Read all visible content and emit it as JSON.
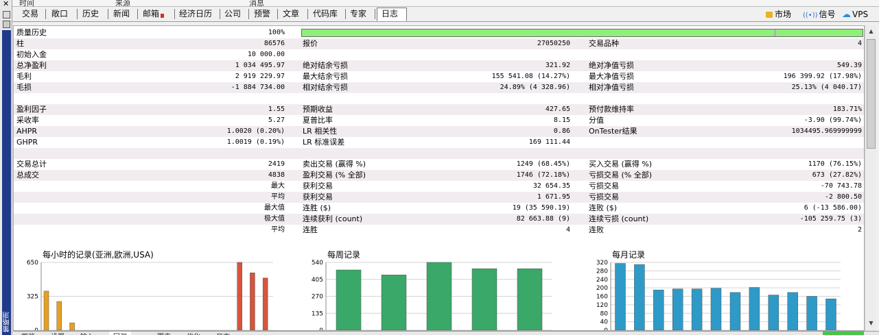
{
  "top_remnant": [
    "时间",
    "来源",
    "消息"
  ],
  "tabs": [
    "交易",
    "敞口",
    "历史",
    "新闻",
    "邮箱",
    "经济日历",
    "公司",
    "预警",
    "文章",
    "代码库",
    "专家",
    "日志"
  ],
  "active_tab": "日志",
  "top_right": {
    "market": "市场",
    "signals": "信号",
    "vps": "VPS"
  },
  "side_label": "策略测试",
  "quality": {
    "label": "质量历史",
    "value": "100%",
    "fill_fraction": 1.0
  },
  "rows": [
    {
      "c1l": "柱",
      "c1v": "86576",
      "c2l": "报价",
      "c2v": "27050250",
      "c3l": "交易品种",
      "c3v": "4"
    },
    {
      "c1l": "初始入金",
      "c1v": "10 000.00",
      "c2l": "",
      "c2v": "",
      "c3l": "",
      "c3v": ""
    },
    {
      "c1l": "总净盈利",
      "c1v": "1 034 495.97",
      "c2l": "绝对结余亏损",
      "c2v": "321.92",
      "c3l": "绝对净值亏损",
      "c3v": "549.39"
    },
    {
      "c1l": "毛利",
      "c1v": "2 919 229.97",
      "c2l": "最大结余亏损",
      "c2v": "155 541.08 (14.27%)",
      "c3l": "最大净值亏损",
      "c3v": "196 399.92 (17.98%)"
    },
    {
      "c1l": "毛损",
      "c1v": "-1 884 734.00",
      "c2l": "相对结余亏损",
      "c2v": "24.89% (4 328.96)",
      "c3l": "相对净值亏损",
      "c3v": "25.13% (4 040.17)"
    },
    {
      "c1l": "",
      "c1v": "",
      "c2l": "",
      "c2v": "",
      "c3l": "",
      "c3v": ""
    },
    {
      "c1l": "盈利因子",
      "c1v": "1.55",
      "c2l": "预期收益",
      "c2v": "427.65",
      "c3l": "预付款维持率",
      "c3v": "183.71%"
    },
    {
      "c1l": "采收率",
      "c1v": "5.27",
      "c2l": "夏普比率",
      "c2v": "8.15",
      "c3l": "分值",
      "c3v": "-3.90 (99.74%)"
    },
    {
      "c1l": "AHPR",
      "c1v": "1.0020 (0.20%)",
      "c2l": "LR 相关性",
      "c2v": "0.86",
      "c3l": "OnTester结果",
      "c3v": "1034495.969999999"
    },
    {
      "c1l": "GHPR",
      "c1v": "1.0019 (0.19%)",
      "c2l": "LR 标准误差",
      "c2v": "169 111.44",
      "c3l": "",
      "c3v": ""
    },
    {
      "c1l": "",
      "c1v": "",
      "c2l": "",
      "c2v": "",
      "c3l": "",
      "c3v": ""
    },
    {
      "c1l": "交易总计",
      "c1v": "2419",
      "c2l": "卖出交易 (赢得 %)",
      "c2v": "1249 (68.45%)",
      "c3l": "买入交易 (赢得 %)",
      "c3v": "1170 (76.15%)"
    },
    {
      "c1l": "总成交",
      "c1v": "4838",
      "c2l": "盈利交易 (% 全部)",
      "c2v": "1746 (72.18%)",
      "c3l": "亏损交易 (% 全部)",
      "c3v": "673 (27.82%)"
    },
    {
      "c1l": "",
      "c1v": "最大",
      "c2l": "获利交易",
      "c2v": "32 654.35",
      "c3l": "亏损交易",
      "c3v": "-70 743.78"
    },
    {
      "c1l": "",
      "c1v": "平均",
      "c2l": "获利交易",
      "c2v": "1 671.95",
      "c3l": "亏损交易",
      "c3v": "-2 800.50"
    },
    {
      "c1l": "",
      "c1v": "最大值",
      "c2l": "连胜 ($)",
      "c2v": "19 (35 590.19)",
      "c3l": "连败 ($)",
      "c3v": "6 (-13 586.00)"
    },
    {
      "c1l": "",
      "c1v": "极大值",
      "c2l": "连续获利 (count)",
      "c2v": "82 663.88 (9)",
      "c3l": "连续亏损 (count)",
      "c3v": "-105 259.75 (3)"
    },
    {
      "c1l": "",
      "c1v": "平均",
      "c2l": "连胜",
      "c2v": "4",
      "c3l": "连败",
      "c3v": "2"
    }
  ],
  "charts": [
    {
      "title": "每小时的记录(亚洲,欧洲,USA)",
      "yticks": [
        "650",
        "325",
        "0"
      ],
      "ymax": 650,
      "bars": [
        {
          "slot": 0,
          "value": 375,
          "color": "#e8a020"
        },
        {
          "slot": 1,
          "value": 275,
          "color": "#e8a020"
        },
        {
          "slot": 2,
          "value": 70,
          "color": "#e8a020"
        },
        {
          "slot": 15,
          "value": 650,
          "color": "#d8543c"
        },
        {
          "slot": 16,
          "value": 550,
          "color": "#d8543c"
        },
        {
          "slot": 17,
          "value": 500,
          "color": "#d8543c"
        }
      ],
      "slots": 18
    },
    {
      "title": "每周记录",
      "yticks": [
        "540",
        "405",
        "270",
        "135",
        "0"
      ],
      "ymax": 540,
      "bars": [
        {
          "slot": 0,
          "value": 480,
          "color": "#3aa868"
        },
        {
          "slot": 1,
          "value": 440,
          "color": "#3aa868"
        },
        {
          "slot": 2,
          "value": 540,
          "color": "#3aa868"
        },
        {
          "slot": 3,
          "value": 490,
          "color": "#3aa868"
        },
        {
          "slot": 4,
          "value": 490,
          "color": "#3aa868"
        }
      ],
      "slots": 5
    },
    {
      "title": "每月记录",
      "yticks": [
        "320",
        "280",
        "240",
        "200",
        "160",
        "120",
        "80",
        "40",
        "0"
      ],
      "ymax": 320,
      "bars": [
        {
          "slot": 0,
          "value": 315,
          "color": "#2e9ac8"
        },
        {
          "slot": 1,
          "value": 310,
          "color": "#2e9ac8"
        },
        {
          "slot": 2,
          "value": 190,
          "color": "#2e9ac8"
        },
        {
          "slot": 3,
          "value": 195,
          "color": "#2e9ac8"
        },
        {
          "slot": 4,
          "value": 195,
          "color": "#2e9ac8"
        },
        {
          "slot": 5,
          "value": 198,
          "color": "#2e9ac8"
        },
        {
          "slot": 6,
          "value": 178,
          "color": "#2e9ac8"
        },
        {
          "slot": 7,
          "value": 202,
          "color": "#2e9ac8"
        },
        {
          "slot": 8,
          "value": 166,
          "color": "#2e9ac8"
        },
        {
          "slot": 9,
          "value": 178,
          "color": "#2e9ac8"
        },
        {
          "slot": 10,
          "value": 160,
          "color": "#2e9ac8"
        },
        {
          "slot": 11,
          "value": 148,
          "color": "#2e9ac8"
        }
      ],
      "slots": 12
    }
  ],
  "bottom_tabs": [
    "概览",
    "设置",
    "输入",
    "回测",
    "图表",
    "优化",
    "日志"
  ]
}
